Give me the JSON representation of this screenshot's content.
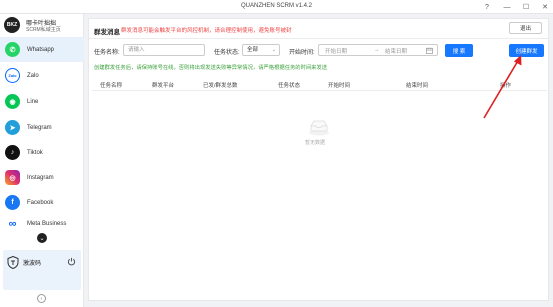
{
  "window": {
    "title": "QUANZHEN SCRM v1.4.2"
  },
  "brand": {
    "logo_text": "BKZ",
    "name": "哪卡叶拙拙",
    "sub": "SCRM私域主页"
  },
  "sidebar": {
    "items": [
      {
        "label": "Whatsapp",
        "icon": "whatsapp-icon",
        "color": "#25d366",
        "glyph": "✆"
      },
      {
        "label": "Zalo",
        "icon": "zalo-icon",
        "color": "#ffffff",
        "glyph": "Zalo"
      },
      {
        "label": "Line",
        "icon": "line-icon",
        "color": "#06c755",
        "glyph": "◉"
      },
      {
        "label": "Telegram",
        "icon": "telegram-icon",
        "color": "#229ed9",
        "glyph": "➤"
      },
      {
        "label": "Tiktok",
        "icon": "tiktok-icon",
        "color": "#111111",
        "glyph": "♪"
      },
      {
        "label": "Instagram",
        "icon": "instagram-icon",
        "color": "#e1306c",
        "glyph": "◎"
      },
      {
        "label": "Facebook",
        "icon": "facebook-icon",
        "color": "#1877f2",
        "glyph": "f"
      },
      {
        "label": "Meta Business",
        "icon": "meta-icon",
        "color": "#0866ff",
        "glyph": "∞"
      }
    ],
    "user_name": "激波码"
  },
  "header": {
    "title": "群发消息",
    "note": "群发消息可能会触发平台的风控机制，请合理控制使用，避免账号被封",
    "exit_label": "退出"
  },
  "filters": {
    "task_name_label": "任务名称:",
    "task_name_placeholder": "请输入",
    "status_label": "任务状态:",
    "status_value": "全部",
    "start_time_label": "开始时间:",
    "start_placeholder": "开始日期",
    "range_sep": "→",
    "end_placeholder": "结束日期",
    "search_label": "搜 索",
    "create_label": "创建群发"
  },
  "tip": "创建群发任务后，请保持账号在线，否则将出现发送失败等异常情况，请严格根据任务的时间来发送",
  "table": {
    "columns": [
      "任务名称",
      "群发平台",
      "已发/群发总数",
      "任务状态",
      "开始时间",
      "结束时间",
      "操作"
    ],
    "rows": [],
    "empty_text": "暂无数据"
  },
  "colors": {
    "accent": "#1677ff",
    "warning": "#e44444",
    "tip": "#3aa13a",
    "annotation_arrow": "#e02020"
  }
}
